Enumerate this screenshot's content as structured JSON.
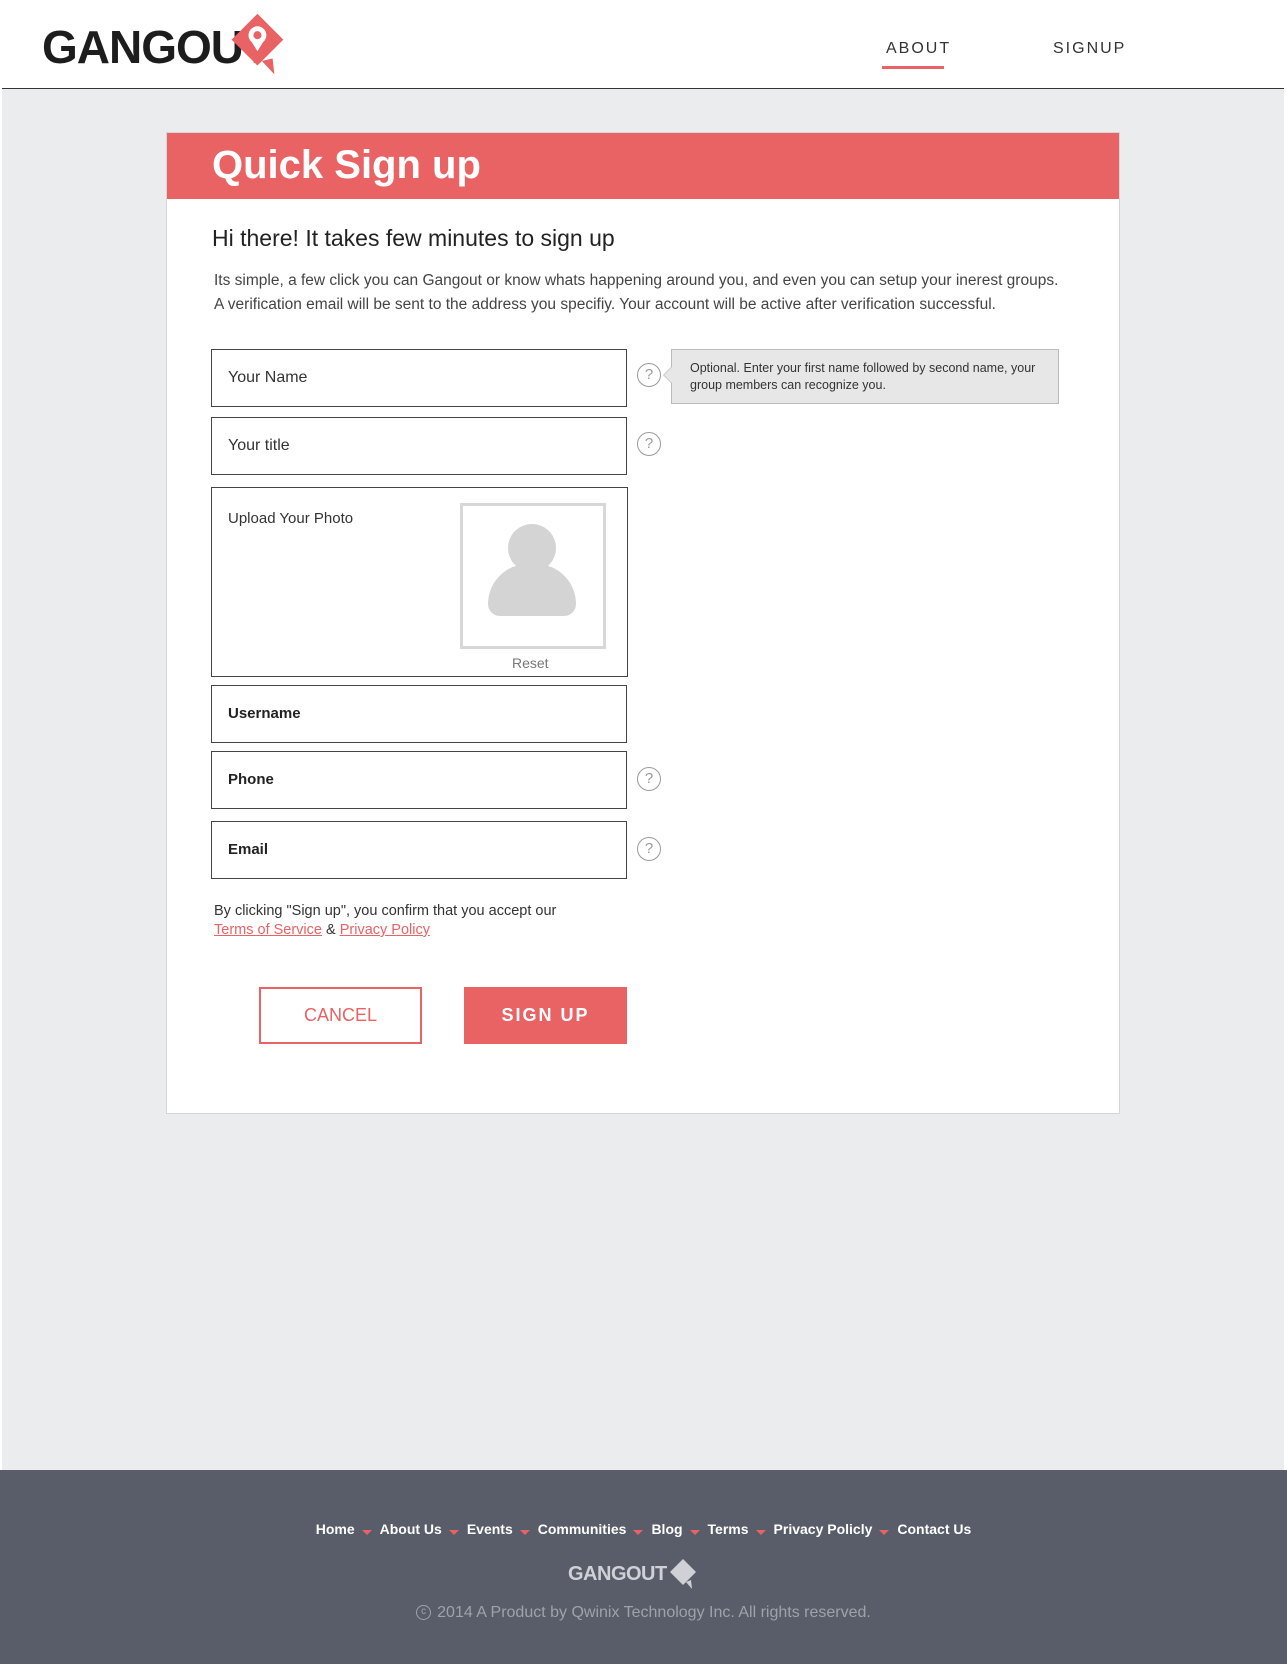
{
  "header": {
    "logo_text": "GANGOUT",
    "nav": {
      "about": "ABOUT",
      "signup": "SIGNUP"
    },
    "active_nav": "ABOUT"
  },
  "form": {
    "title": "Quick Sign up",
    "greeting": "Hi there!  It takes few minutes to sign up",
    "intro_line1": "Its simple, a few click you can Gangout or know whats happening around you, and even you can setup your inerest groups.",
    "intro_line2": "A verification email will be sent to the address you specifiy.  Your account will be active after verification successful.",
    "fields": {
      "name": "Your Name",
      "title": "Your title",
      "photo": "Upload Your Photo",
      "username": "Username",
      "phone": "Phone",
      "email": "Email"
    },
    "help_symbol": "?",
    "tooltip": "Optional. Enter your first name followed by second name, your group members can recognize you.",
    "photo_reset": "Reset",
    "terms_prefix": "By clicking \"Sign up\", you confirm that you accept our",
    "terms_link": "Terms of Service",
    "terms_and": "&",
    "privacy_link": "Privacy Policy",
    "cancel_label": "CANCEL",
    "signup_label": "SIGN UP"
  },
  "footer": {
    "nav": [
      "Home",
      "About Us",
      "Events",
      "Communities",
      "Blog",
      "Terms",
      "Privacy Policly",
      "Contact Us"
    ],
    "logo_text": "GANGOUT",
    "copyright_symbol": "c",
    "copyright": "2014 A Product by Qwinix Technology Inc.  All rights reserved."
  },
  "colors": {
    "accent": "#e96264",
    "footer_bg": "#585d69",
    "page_bg": "#ebecee"
  }
}
